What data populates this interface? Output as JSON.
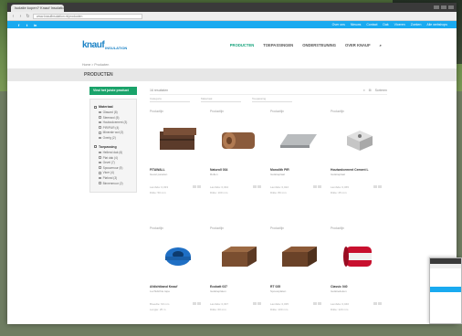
{
  "browser": {
    "tab_title": "Isolatie kopen? Knauf Insulation",
    "url": "www.knaufinsulation.nl/producten"
  },
  "topstrip": {
    "social": [
      "f",
      "t",
      "in"
    ],
    "links": [
      "Over ons",
      "Nieuws",
      "Contact",
      "Dak",
      "Vloeren",
      "Zoeken",
      "Alle webshops"
    ]
  },
  "header": {
    "logo_main": "knauf",
    "logo_sub": "INSULATION",
    "nav": [
      "PRODUCTEN",
      "TOEPASSINGEN",
      "ONDERSTEUNING",
      "OVER KNAUF"
    ],
    "active_nav": "PRODUCTEN"
  },
  "breadcrumb": "Home  >  Producten",
  "page_title": "PRODUCTEN",
  "sidebar": {
    "filter_button": "Vind het juiste product",
    "groups": [
      {
        "title": "Materiaal",
        "items": [
          "Glaswol (8)",
          "Steenwol (5)",
          "Houtwolcement (3)",
          "PIR/PUR (4)",
          "Minerale wol (3)",
          "Overig (2)"
        ]
      },
      {
        "title": "Toepassing",
        "items": [
          "Hellend dak (6)",
          "Plat dak (4)",
          "Gevel (7)",
          "Spouwmuur (5)",
          "Vloer (4)",
          "Plafond (3)",
          "Binnenmuur (2)"
        ]
      }
    ]
  },
  "toolbar": {
    "result_count": "16 resultaten",
    "right_items": [
      "≡",
      "⊞",
      "Sorteren"
    ]
  },
  "sortrow": [
    "Categorie",
    "Materiaal",
    "Toepassing"
  ],
  "products": [
    {
      "label": "Productlijn",
      "name": "FITAWALL",
      "sub": "Gevel panelen",
      "meta1": "Lambda: 0,033",
      "meta2": "Dikte: 50 mm",
      "img": "brick-dark"
    },
    {
      "label": "Productlijn",
      "name": "Naturoll 034",
      "sub": "Rollen",
      "meta1": "Lambda: 0,034",
      "meta2": "Dikte: 100 mm",
      "img": "roll-brown"
    },
    {
      "label": "Productlijn",
      "name": "Monolith PIR",
      "sub": "Isolatieplaat",
      "meta1": "Lambda: 0,022",
      "meta2": "Dikte: 80 mm",
      "img": "panel-grey"
    },
    {
      "label": "Productlijn",
      "name": "Houtwolcement Cement L",
      "sub": "Isolatieplaat",
      "meta1": "Lambda: 0,065",
      "meta2": "Dikte: 25 mm",
      "img": "block-stone"
    },
    {
      "label": "Productlijn",
      "name": "Afdichtband Knauf",
      "sub": "Luchtdichte tape",
      "meta1": "Breedte: 60 mm",
      "meta2": "Lengte: 25 m",
      "img": "tape-blue"
    },
    {
      "label": "Productlijn",
      "name": "Ecobatt 037",
      "sub": "Isolatieplaten",
      "meta1": "Lambda: 0,037",
      "meta2": "Dikte: 60 mm",
      "img": "batt-brown"
    },
    {
      "label": "Productlijn",
      "name": "RT 035",
      "sub": "Spouwplaten",
      "meta1": "Lambda: 0,035",
      "meta2": "Dikte: 100 mm",
      "img": "batt-brown2"
    },
    {
      "label": "Productlijn",
      "name": "Classic 040",
      "sub": "Isolatiedeken",
      "meta1": "Lambda: 0,040",
      "meta2": "Dikte: 120 mm",
      "img": "roll-red"
    }
  ],
  "colors": {
    "accent_blue": "#19aaf0",
    "filter_green": "#1aa36a",
    "nav_active": "#17a37c",
    "logo_blue": "#1c83c6"
  }
}
